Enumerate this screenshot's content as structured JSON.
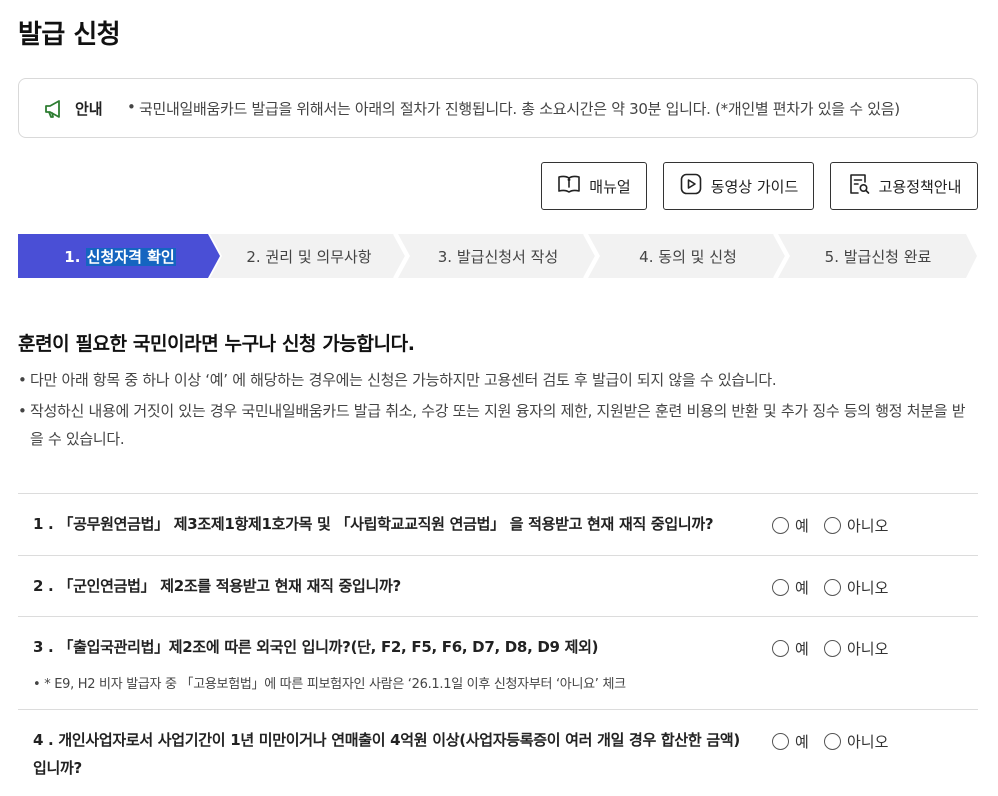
{
  "page": {
    "title": "발급 신청"
  },
  "notice": {
    "label": "안내",
    "bullet": "•",
    "text": "국민내일배움카드 발급을 위해서는 아래의 절차가 진행됩니다. 총 소요시간은 약 30분 입니다. (*개인별 편차가 있을 수 있음)"
  },
  "buttons": {
    "manual": "매뉴얼",
    "video": "동영상 가이드",
    "policy": "고용정책안내"
  },
  "steps": [
    {
      "num": "1.",
      "label": "신청자격 확인",
      "active": true
    },
    {
      "num": "2.",
      "label": "권리 및 의무사항",
      "active": false
    },
    {
      "num": "3.",
      "label": "발급신청서 작성",
      "active": false
    },
    {
      "num": "4.",
      "label": "동의 및 신청",
      "active": false
    },
    {
      "num": "5.",
      "label": "발급신청 완료",
      "active": false
    }
  ],
  "intro": {
    "heading": "훈련이 필요한 국민이라면 누구나 신청 가능합니다.",
    "bullets": [
      "다만 아래 항목 중 하나 이상 ‘예’ 에 해당하는 경우에는 신청은 가능하지만 고용센터 검토 후 발급이 되지 않을 수 있습니다.",
      "작성하신 내용에 거짓이 있는 경우 국민내일배움카드 발급 취소, 수강 또는 지원 융자의 제한, 지원받은 훈련 비용의 반환 및 추가 징수 등의 행정 처분을 받을 수 있습니다."
    ]
  },
  "questions": [
    {
      "text": "1 . 「공무원연금법」 제3조제1항제1호가목 및 「사립학교교직원 연금법」 을 적용받고 현재 재직 중입니까?",
      "note": ""
    },
    {
      "text": "2 . 「군인연금법」 제2조를 적용받고 현재 재직 중입니까?",
      "note": ""
    },
    {
      "text": "3 . 「출입국관리법」제2조에 따른 외국인 입니까?(단, F2, F5, F6, D7, D8, D9 제외)",
      "note": "• * E9, H2 비자 발급자 중 「고용보험법」에 따른 피보험자인 사람은 ‘26.1.1일 이후 신청자부터 ‘아니요’ 체크"
    },
    {
      "text": "4 . 개인사업자로서 사업기간이 1년 미만이거나 연매출이 4억원 이상(사업자등록증이 여러 개일 경우 합산한 금액) 입니까?",
      "note": ""
    }
  ],
  "radio": {
    "yes": "예",
    "no": "아니오"
  },
  "colors": {
    "accent": "#4a4fd6",
    "step_bg": "#f2f2f2",
    "highlight": "#1565c0",
    "icon_green": "#2e7d32"
  }
}
